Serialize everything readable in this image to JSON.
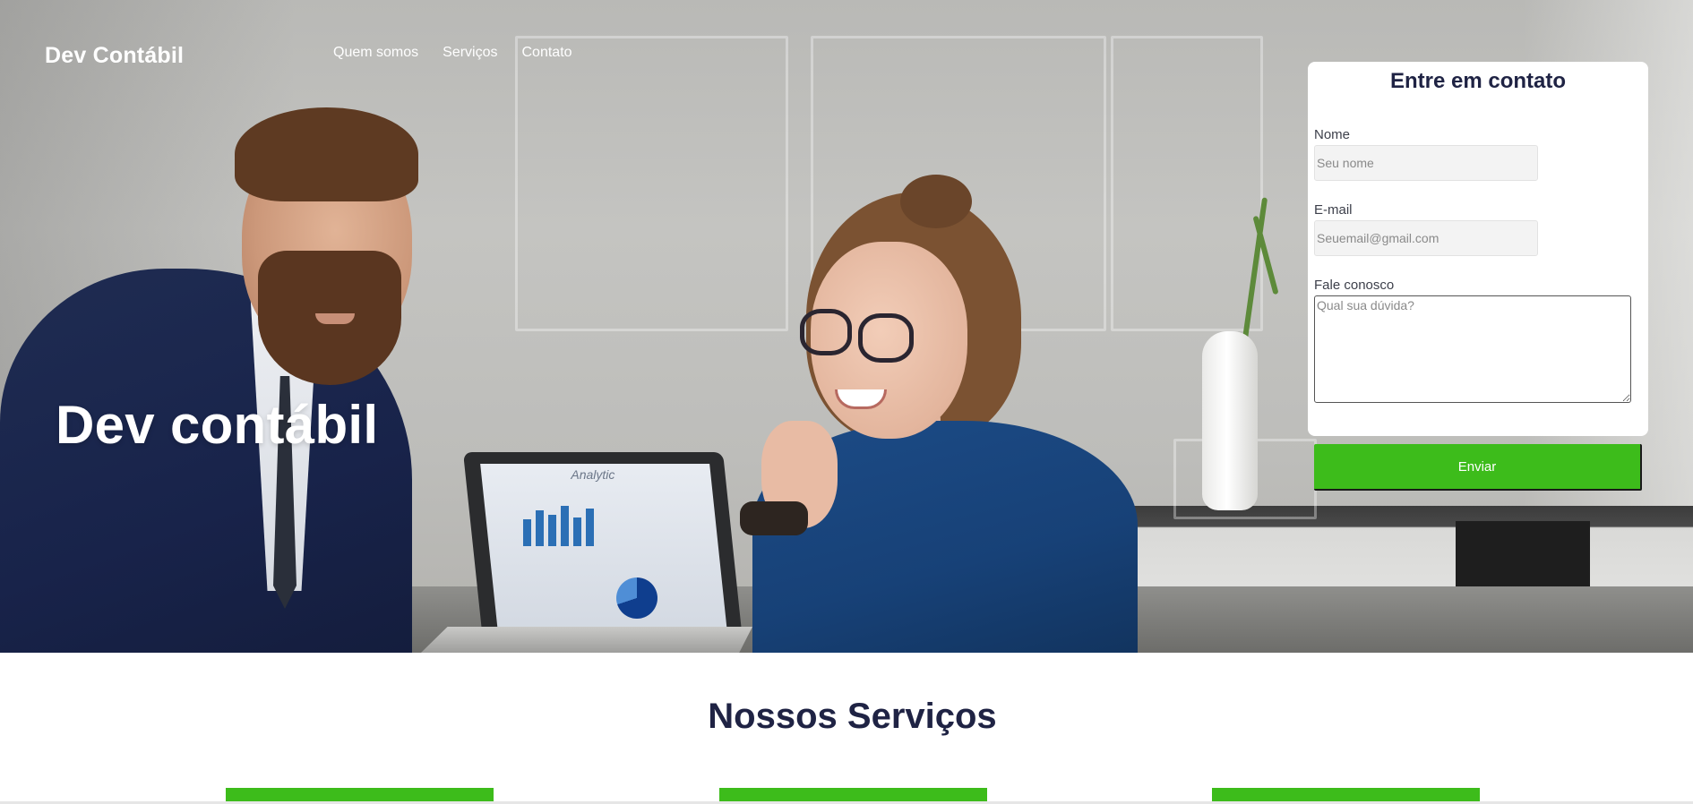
{
  "nav": {
    "brand": "Dev Contábil",
    "links": [
      "Quem somos",
      "Serviços",
      "Contato"
    ]
  },
  "hero": {
    "title": "Dev contábil",
    "laptop_caption": "Analytic"
  },
  "contact_form": {
    "title": "Entre em contato",
    "name_label": "Nome",
    "name_placeholder": "Seu nome",
    "email_label": "E-mail",
    "email_placeholder": "Seuemail@gmail.com",
    "message_label": "Fale conosco",
    "message_placeholder": "Qual sua dúvida?",
    "submit_label": "Enviar"
  },
  "services": {
    "title": "Nossos Serviços",
    "card_count_visible": 3
  },
  "colors": {
    "accent_green": "#3dbc1b",
    "heading_navy": "#1f2344",
    "white": "#ffffff"
  }
}
